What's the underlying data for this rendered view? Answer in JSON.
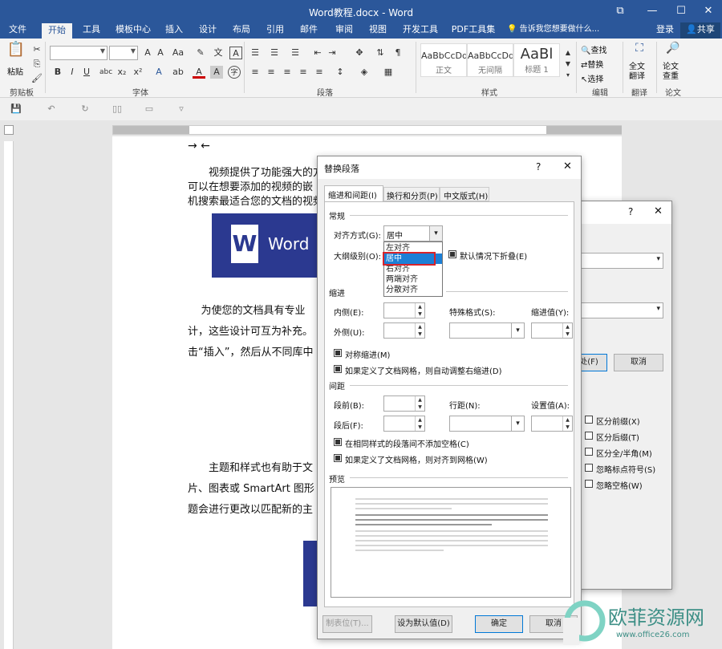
{
  "window": {
    "title": "Word教程.docx - Word"
  },
  "tabs": [
    "文件",
    "开始",
    "工具",
    "模板中心",
    "插入",
    "设计",
    "布局",
    "引用",
    "邮件",
    "审阅",
    "视图",
    "开发工具",
    "PDF工具集"
  ],
  "tell_me": "告诉我您想要做什么...",
  "login": "登录",
  "share": "共享",
  "ribbon": {
    "paste": "粘贴",
    "groups": {
      "clipboard": "剪贴板",
      "font": "字体",
      "paragraph": "段落",
      "styles": "样式",
      "edit": "编辑",
      "translate": "翻译",
      "paper": "论文"
    },
    "styles": [
      {
        "preview": "AaBbCcDd",
        "name": "正文"
      },
      {
        "preview": "AaBbCcDd",
        "name": "无间隔"
      },
      {
        "preview": "AaBl",
        "name": "标题 1"
      }
    ],
    "find": "查找",
    "replace": "替换",
    "select": "选择",
    "fulltext": "全文\n翻译",
    "paper_check": "论文\n查重"
  },
  "document": {
    "p1": [
      "视频提供了功能强大的方",
      "可以在想要添加的视频的嵌",
      "机搜索最适合您的文档的视频"
    ],
    "logo": "Word",
    "p2": [
      "为使您的文档具有专业",
      "计，这些设计可互为补充。",
      "击“插入”，然后从不同库中"
    ],
    "p3": [
      "主题和样式也有助于文",
      "片、图表或 SmartArt 图形",
      "题会进行更改以匹配新的主"
    ]
  },
  "bg_dialog": {
    "help": "?",
    "btn_replace_one": "一处(F)",
    "btn_cancel": "取消",
    "checks": [
      "区分前缀(X)",
      "区分后缀(T)",
      "区分全/半角(M)",
      "忽略标点符号(S)",
      "忽略空格(W)"
    ]
  },
  "dialog": {
    "title": "替换段落",
    "help": "?",
    "tabs": [
      "缩进和间距(I)",
      "换行和分页(P)",
      "中文版式(H)"
    ],
    "general": "常规",
    "align_label": "对齐方式(G):",
    "align_value": "居中",
    "align_options": [
      "左对齐",
      "居中",
      "右对齐",
      "两端对齐",
      "分散对齐"
    ],
    "outline_label": "大纲级别(O):",
    "collapse_label": "默认情况下折叠(E)",
    "indent": "缩进",
    "inside": "内侧(E):",
    "outside": "外侧(U):",
    "special": "特殊格式(S):",
    "indent_value": "缩进值(Y):",
    "mirror": "对称缩进(M)",
    "auto_adjust": "如果定义了文档网格，则自动调整右缩进(D)",
    "spacing": "间距",
    "before": "段前(B):",
    "after": "段后(F):",
    "line_spacing": "行距(N):",
    "set_value": "设置值(A):",
    "no_space": "在相同样式的段落间不添加空格(C)",
    "snap_grid": "如果定义了文档网格，则对齐到网格(W)",
    "preview": "预览",
    "btn_tabs": "制表位(T)...",
    "btn_default": "设为默认值(D)",
    "btn_ok": "确定",
    "btn_cancel": "取消"
  },
  "watermark": {
    "name": "欧菲资源网",
    "url": "www.office26.com"
  }
}
